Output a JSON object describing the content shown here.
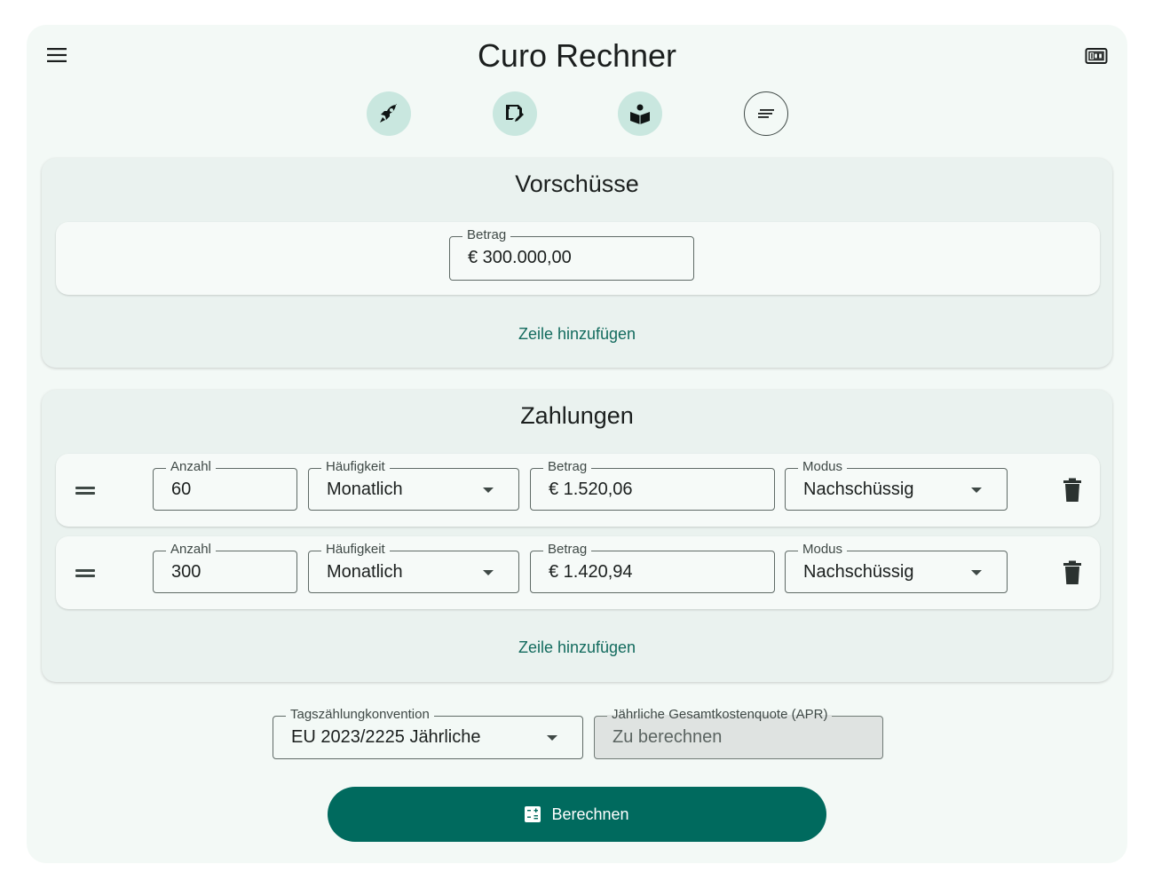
{
  "header": {
    "title": "Curo Rechner",
    "menu_icon": "menu-icon",
    "right_icon": "calculator-display-icon"
  },
  "toolbar": {
    "items": [
      {
        "icon": "rocket-icon"
      },
      {
        "icon": "save-edit-icon"
      },
      {
        "icon": "book-reader-icon"
      },
      {
        "icon": "notes-icon"
      }
    ]
  },
  "advances": {
    "title": "Vorschüsse",
    "rows": [
      {
        "amount_label": "Betrag",
        "amount": "€ 300.000,00"
      }
    ],
    "add_row": "Zeile hinzufügen"
  },
  "payments": {
    "title": "Zahlungen",
    "rows": [
      {
        "count_label": "Anzahl",
        "count": "60",
        "frequency_label": "Häufigkeit",
        "frequency": "Monatlich",
        "amount_label": "Betrag",
        "amount": "€ 1.520,06",
        "mode_label": "Modus",
        "mode": "Nachschüssig"
      },
      {
        "count_label": "Anzahl",
        "count": "300",
        "frequency_label": "Häufigkeit",
        "frequency": "Monatlich",
        "amount_label": "Betrag",
        "amount": "€ 1.420,94",
        "mode_label": "Modus",
        "mode": "Nachschüssig"
      }
    ],
    "add_row": "Zeile hinzufügen"
  },
  "settings": {
    "day_count_label": "Tagszählungkonvention",
    "day_count": "EU 2023/2225 Jährliche",
    "apr_label": "Jährliche Gesamtkostenquote (APR)",
    "apr_value": "Zu berechnen"
  },
  "action": {
    "calculate_label": "Berechnen"
  },
  "colors": {
    "accent": "#006a5e",
    "link": "#136b5e",
    "toolbar_bg": "#c9e7df",
    "surface": "#f3f9f6"
  }
}
